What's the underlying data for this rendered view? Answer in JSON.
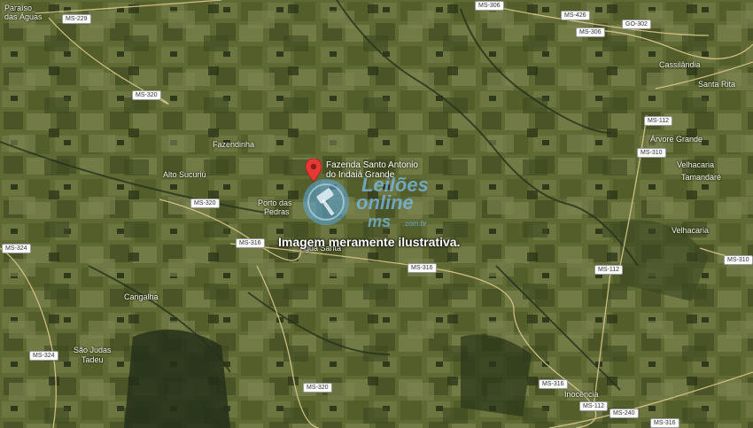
{
  "map": {
    "marker": {
      "line1": "Fazenda Santo Antonio",
      "line2": "do Indaiá Grande",
      "icon": "map-pin-icon",
      "color": "#e53935"
    },
    "caption": "Imagem meramente ilustrativa.",
    "watermark": {
      "line1": "Leilões",
      "line2": "online",
      "line3": "ms",
      "line4": ".com.br",
      "icon": "gavel-icon"
    },
    "places": [
      {
        "name": "place-paraiso-das-aguas-1",
        "text": "Paraíso"
      },
      {
        "name": "place-paraiso-das-aguas-2",
        "text": "das Águas"
      },
      {
        "name": "place-fazendinha",
        "text": "Fazendinha"
      },
      {
        "name": "place-alto-sucuriu",
        "text": "Alto Sucuriú"
      },
      {
        "name": "place-porto-das-pedras-1",
        "text": "Porto das"
      },
      {
        "name": "place-porto-das-pedras-2",
        "text": "Pedras"
      },
      {
        "name": "place-agua-santa",
        "text": "Água Santa"
      },
      {
        "name": "place-cangalha",
        "text": "Cangalha"
      },
      {
        "name": "place-sao-judas-tadeu-1",
        "text": "São Judas"
      },
      {
        "name": "place-sao-judas-tadeu-2",
        "text": "Tadeu"
      },
      {
        "name": "place-cassilandia",
        "text": "Cassilândia"
      },
      {
        "name": "place-santa-rita",
        "text": "Santa Rita"
      },
      {
        "name": "place-arvore-grande",
        "text": "Árvore Grande"
      },
      {
        "name": "place-velhacaria-1",
        "text": "Velhacaria"
      },
      {
        "name": "place-tamandare",
        "text": "Tamandaré"
      },
      {
        "name": "place-velhacaria-2",
        "text": "Velhacaria"
      },
      {
        "name": "place-inocencia",
        "text": "Inocência"
      }
    ],
    "shields": [
      {
        "name": "shield-ms229",
        "text": "MS-229"
      },
      {
        "name": "shield-ms306-a",
        "text": "MS-306"
      },
      {
        "name": "shield-ms426",
        "text": "MS-426"
      },
      {
        "name": "shield-ms306-b",
        "text": "MS-306"
      },
      {
        "name": "shield-go302",
        "text": "GO-302"
      },
      {
        "name": "shield-ms320-a",
        "text": "MS-320"
      },
      {
        "name": "shield-ms112-a",
        "text": "MS-112"
      },
      {
        "name": "shield-ms310",
        "text": "MS-310"
      },
      {
        "name": "shield-ms320-b",
        "text": "MS-320"
      },
      {
        "name": "shield-ms324-a",
        "text": "MS-324"
      },
      {
        "name": "shield-ms316-a",
        "text": "MS-316"
      },
      {
        "name": "shield-ms316-b",
        "text": "MS-316"
      },
      {
        "name": "shield-ms112-b",
        "text": "MS-112"
      },
      {
        "name": "shield-ms310-b",
        "text": "MS-310"
      },
      {
        "name": "shield-ms324-b",
        "text": "MS-324"
      },
      {
        "name": "shield-ms320-c",
        "text": "MS-320"
      },
      {
        "name": "shield-ms316-c",
        "text": "MS-316"
      },
      {
        "name": "shield-ms112-c",
        "text": "MS-112"
      },
      {
        "name": "shield-ms240",
        "text": "MS-240"
      },
      {
        "name": "shield-ms316-d",
        "text": "MS-316"
      }
    ]
  }
}
